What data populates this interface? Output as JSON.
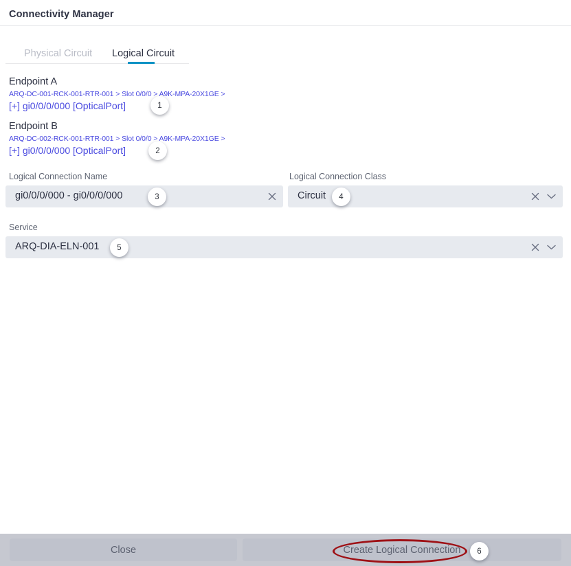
{
  "header": {
    "title": "Connectivity Manager"
  },
  "tabs": [
    {
      "label": "Physical Circuit",
      "active": false
    },
    {
      "label": "Logical Circuit",
      "active": true
    }
  ],
  "endpoints": {
    "a": {
      "label": "Endpoint A",
      "path": "ARQ-DC-001-RCK-001-RTR-001 > Slot 0/0/0 > A9K-MPA-20X1GE >",
      "port": "[+] gi0/0/0/000 [OpticalPort]",
      "badge": "1"
    },
    "b": {
      "label": "Endpoint B",
      "path": "ARQ-DC-002-RCK-001-RTR-001 > Slot 0/0/0 > A9K-MPA-20X1GE >",
      "port": "[+] gi0/0/0/000 [OpticalPort]",
      "badge": "2"
    }
  },
  "fields": {
    "connection_name": {
      "label": "Logical Connection Name",
      "value": "gi0/0/0/000 - gi0/0/0/000",
      "badge": "3"
    },
    "connection_class": {
      "label": "Logical Connection Class",
      "value": "Circuit",
      "badge": "4"
    },
    "service": {
      "label": "Service",
      "value": "ARQ-DIA-ELN-001",
      "badge": "5"
    }
  },
  "footer": {
    "close_label": "Close",
    "create_label": "Create Logical Connection",
    "create_badge": "6"
  },
  "colors": {
    "accent": "#0d92c4",
    "link": "#4a4ae0",
    "field_bg": "#e7eaef",
    "footer_bg": "#c6c8d0",
    "button_bg": "#bfc2cc",
    "annotation": "#9e1015"
  }
}
